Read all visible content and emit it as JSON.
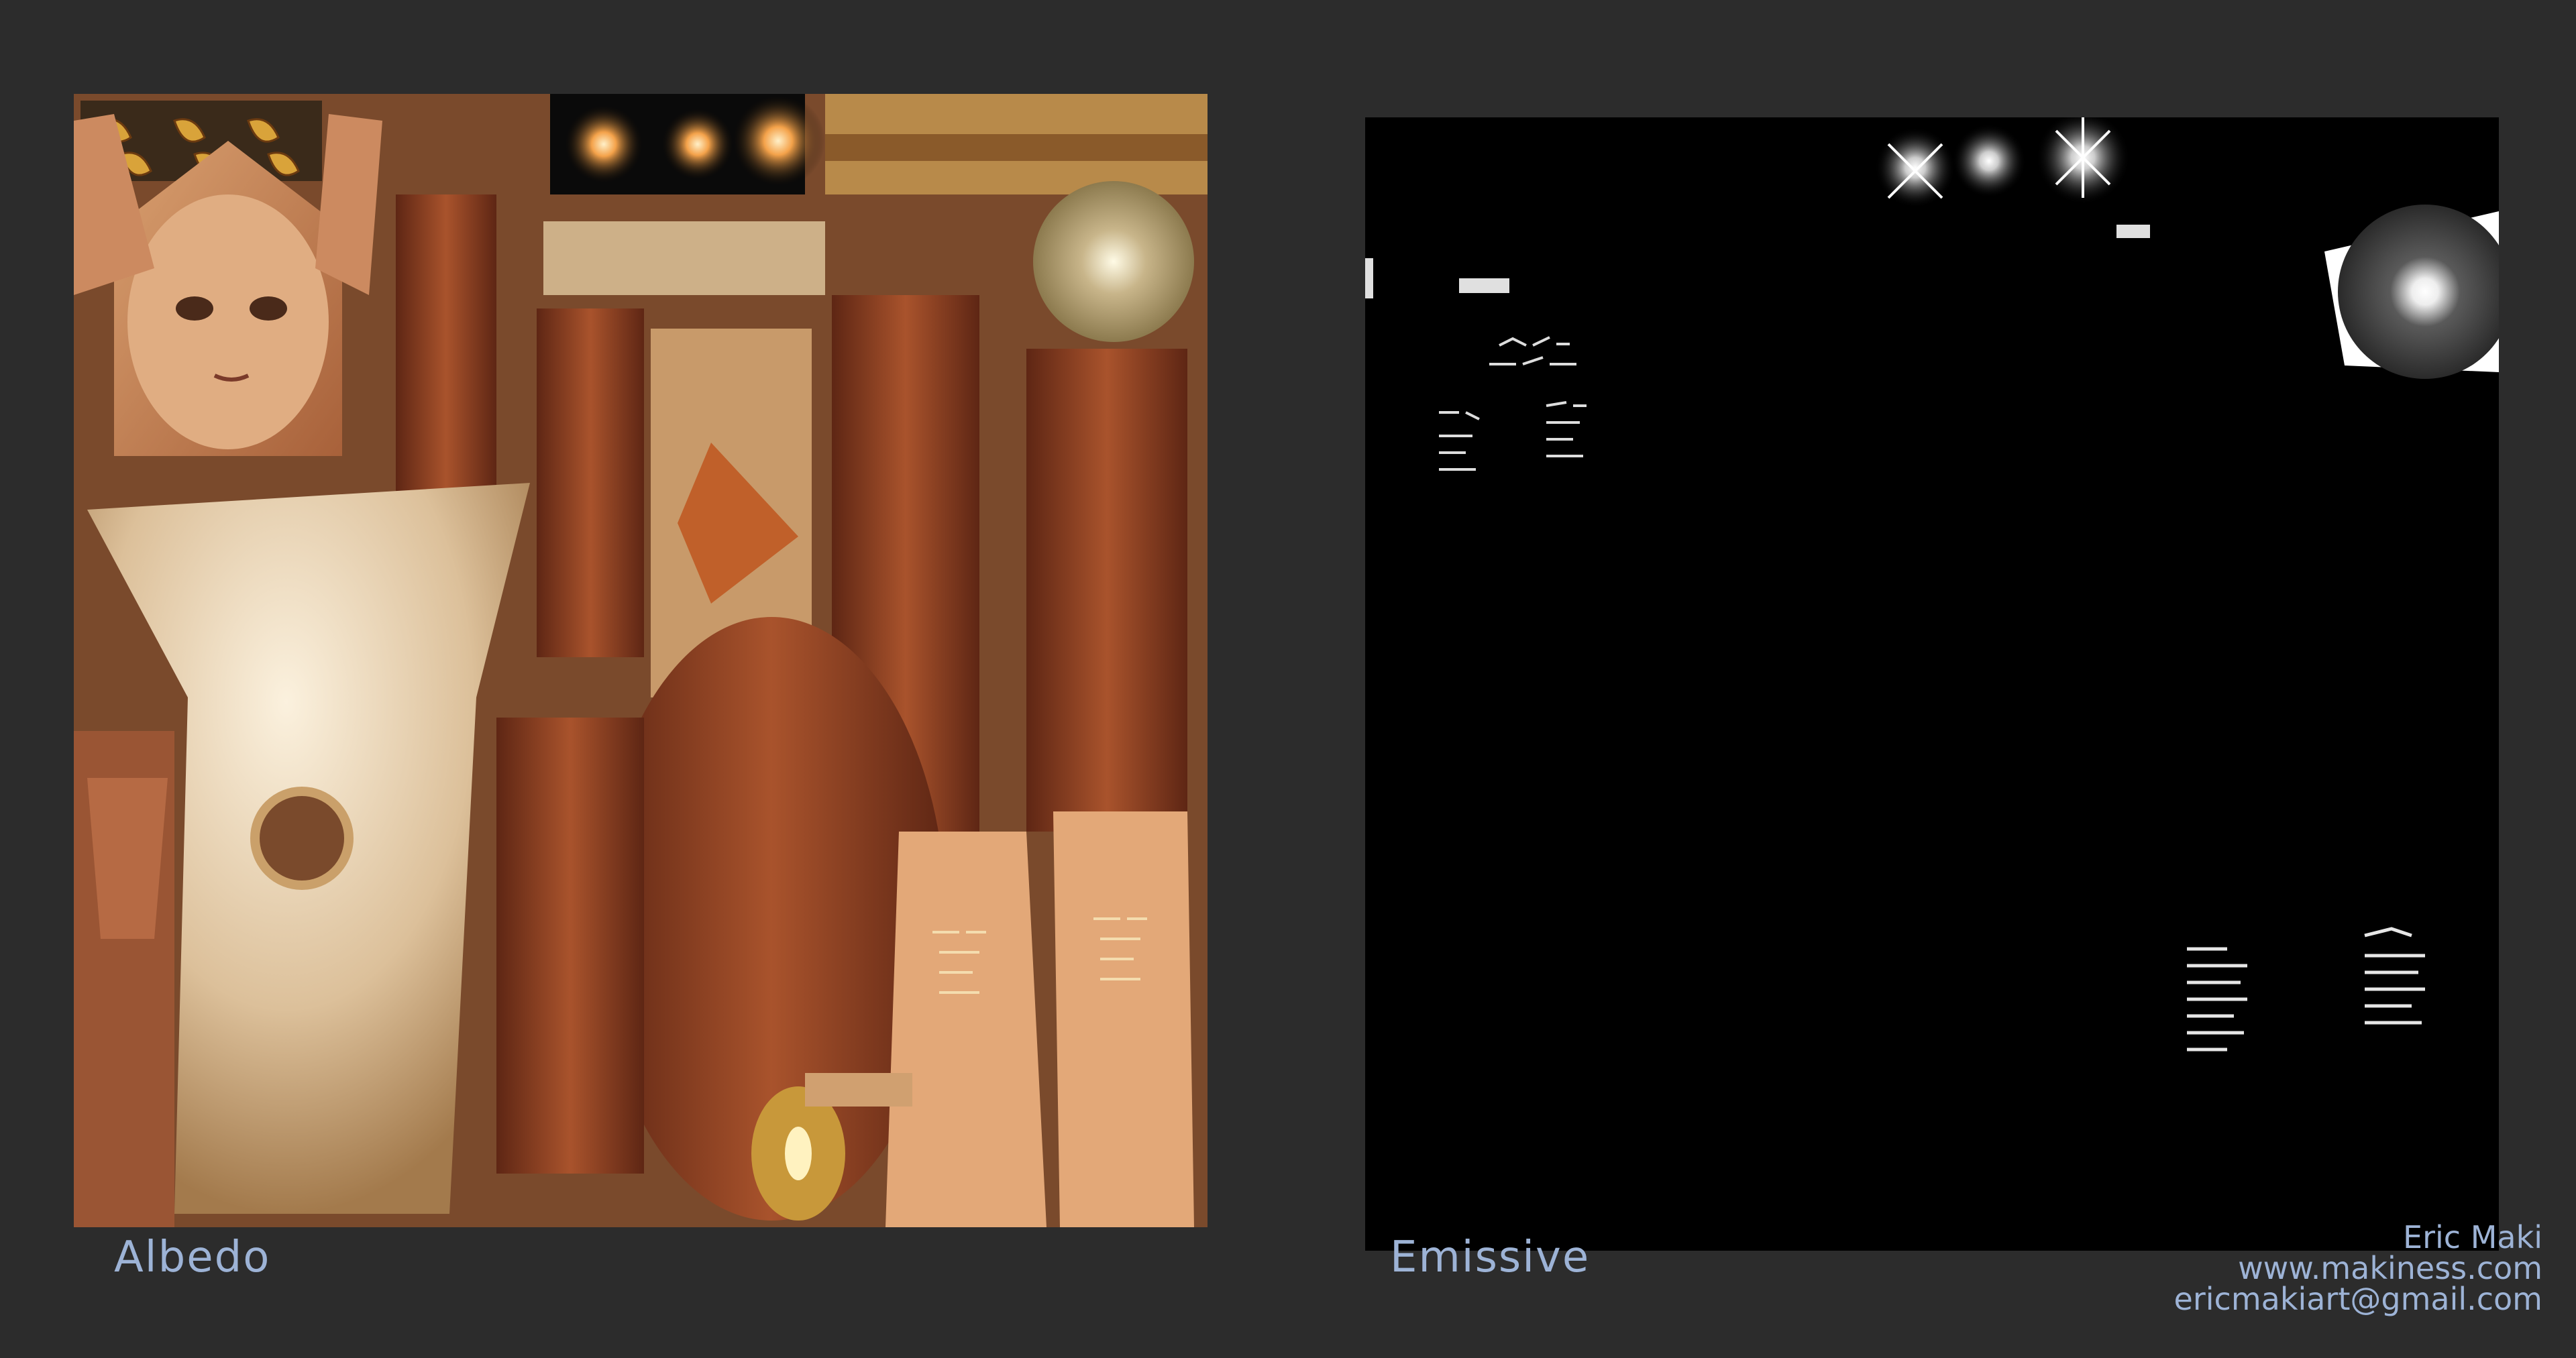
{
  "labels": {
    "albedo": "Albedo",
    "emissive": "Emissive"
  },
  "credits": {
    "name": "Eric Maki",
    "website": "www.makiness.com",
    "email": "ericmakiart@gmail.com"
  },
  "colors": {
    "background": "#2c2c2c",
    "label": "#9db3d6",
    "skin": "#c98a5c",
    "hair": "#8a3f22",
    "robe": "#e6d2ae",
    "emissive_bg": "#000000"
  }
}
